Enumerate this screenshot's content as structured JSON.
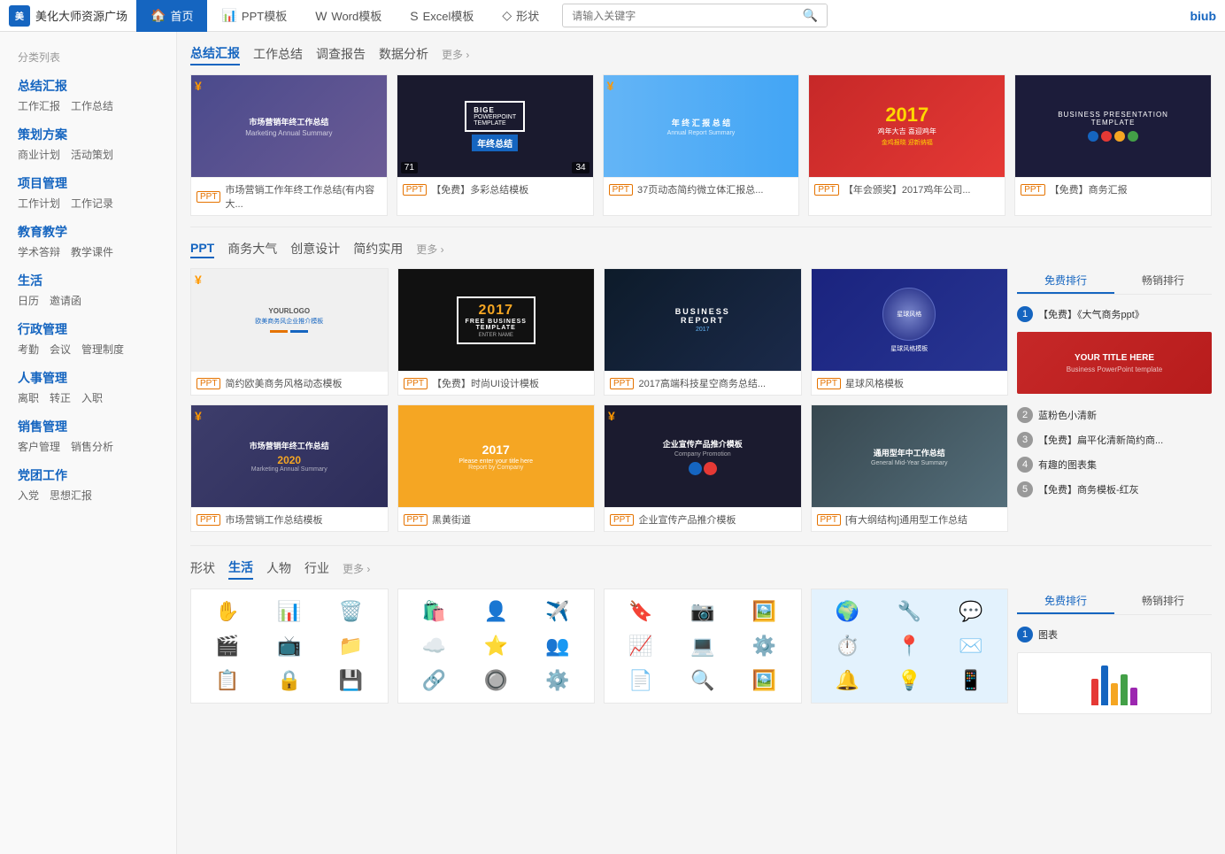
{
  "nav": {
    "logo": "美化大师资源广场",
    "items": [
      {
        "label": "首页",
        "icon": "🏠",
        "active": true
      },
      {
        "label": "PPT模板",
        "icon": "📊",
        "active": false
      },
      {
        "label": "Word模板",
        "icon": "W",
        "active": false
      },
      {
        "label": "Excel模板",
        "icon": "S",
        "active": false
      },
      {
        "label": "形状",
        "icon": "◇",
        "active": false
      }
    ],
    "search_placeholder": "请输入关键字",
    "brand": "biub"
  },
  "sidebar": {
    "category_label": "分类列表",
    "categories": [
      {
        "title": "总结汇报",
        "subs": [
          "工作汇报",
          "工作总结"
        ]
      },
      {
        "title": "策划方案",
        "subs": [
          "商业计划",
          "活动策划"
        ]
      },
      {
        "title": "项目管理",
        "subs": [
          "工作计划",
          "工作记录"
        ]
      },
      {
        "title": "教育教学",
        "subs": [
          "学术答辩",
          "教学课件"
        ]
      },
      {
        "title": "生活",
        "subs": [
          "日历",
          "邀请函"
        ]
      },
      {
        "title": "行政管理",
        "subs": [
          "考勤",
          "会议",
          "管理制度"
        ]
      },
      {
        "title": "人事管理",
        "subs": [
          "离职",
          "转正",
          "入职"
        ]
      },
      {
        "title": "销售管理",
        "subs": [
          "客户管理",
          "销售分析"
        ]
      },
      {
        "title": "党团工作",
        "subs": [
          "入党",
          "思想汇报"
        ]
      }
    ]
  },
  "section1": {
    "tabs": [
      "总结汇报",
      "工作总结",
      "调查报告",
      "数据分析"
    ],
    "active_tab": "总结汇报",
    "more": "更多",
    "templates": [
      {
        "label": "市场营销工作年终工作总结(有内容大...",
        "type": "PPT",
        "has_yen": true
      },
      {
        "label": "【免费】多彩总结模板",
        "type": "PPT",
        "num": "34",
        "num2": "71"
      },
      {
        "label": "37页动态简约微立体汇报总...",
        "type": "PPT",
        "has_yen": true
      },
      {
        "label": "【年会颁奖】2017鸡年公司...",
        "type": "PPT"
      },
      {
        "label": "【免费】商务汇报",
        "type": "PPT"
      }
    ]
  },
  "section2": {
    "tabs": [
      "PPT",
      "商务大气",
      "创意设计",
      "简约实用"
    ],
    "active_tab": "PPT",
    "more": "更多",
    "templates_row1": [
      {
        "label": "简约欧美商务风格动态模板",
        "type": "PPT"
      },
      {
        "label": "【免费】时尚UI设计模板",
        "type": "PPT"
      },
      {
        "label": "2017高端科技星空商务总结...",
        "type": "PPT"
      },
      {
        "label": "星球风格模板",
        "type": "PPT"
      }
    ],
    "templates_row2": [
      {
        "label": "市场营销工作总结模板",
        "type": "PPT",
        "has_yen": true
      },
      {
        "label": "黑黄街道",
        "type": "PPT"
      },
      {
        "label": "企业宣传产品推介模板",
        "type": "PPT",
        "has_yen": true
      },
      {
        "label": "[有大纲结构]通用型工作总结",
        "type": "PPT"
      }
    ],
    "rank": {
      "tabs": [
        "免费排行",
        "畅销排行"
      ],
      "active": "免费排行",
      "items": [
        {
          "num": "1",
          "label": "【免费】《大气商务ppt》",
          "top": true
        },
        {
          "num": "2",
          "label": "蓝粉色小清新"
        },
        {
          "num": "3",
          "label": "【免费】扁平化清新简约商..."
        },
        {
          "num": "4",
          "label": "有趣的图表集"
        },
        {
          "num": "5",
          "label": "【免费】商务模板-红灰"
        }
      ]
    }
  },
  "section3": {
    "tabs": [
      "形状",
      "生活",
      "人物",
      "行业"
    ],
    "active_tab": "生活",
    "more": "更多",
    "rank": {
      "tabs": [
        "免费排行",
        "畅销排行"
      ],
      "active": "免费排行",
      "items": [
        {
          "num": "1",
          "label": "图表",
          "top": true
        }
      ]
    }
  },
  "thumb_labels": {
    "bige": "BIGE POWERPOINT TEMPLATE 年终总结",
    "free_business": "FREE BUSINESS 2017 TEMPLATE ENTER NAME",
    "business_report": "BUSINESS REPORT 2017",
    "star_style": "星球风格模板",
    "mkt_2020": "市场营销年终工作总结 2020",
    "city_2017": "2017 Please enter your title here",
    "corp_promo": "企业宣传产品推介模板",
    "mountain_work": "通用型年中工作总结",
    "yourlogo": "欧美商务风企业推介模板",
    "business_template": "BUSINESS PRESENTATION TEMPLATE"
  }
}
